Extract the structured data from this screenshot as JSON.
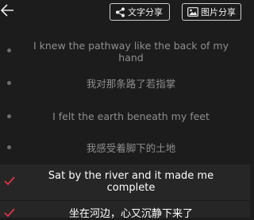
{
  "toolbar": {
    "back_icon": "arrow-left-icon",
    "text_share_label": "文字分享",
    "text_share_icon": "share-icon",
    "image_share_label": "图片分享",
    "image_share_icon": "image-icon"
  },
  "colors": {
    "background": "#1c1c1c",
    "selected_row_bg": "#262626",
    "check_color": "#e0334a",
    "dim_text": "#8f8f8f"
  },
  "lyrics": [
    {
      "text": "I knew the pathway like the back of my hand",
      "selected": false
    },
    {
      "text": "我对那条路了若指掌",
      "selected": false
    },
    {
      "text": "I felt the earth beneath my feet",
      "selected": false
    },
    {
      "text": "我感受着脚下的土地",
      "selected": false
    },
    {
      "text": "Sat by the river and it made me complete",
      "selected": true
    },
    {
      "text": "坐在河边，心又沉静下来了",
      "selected": true
    }
  ]
}
